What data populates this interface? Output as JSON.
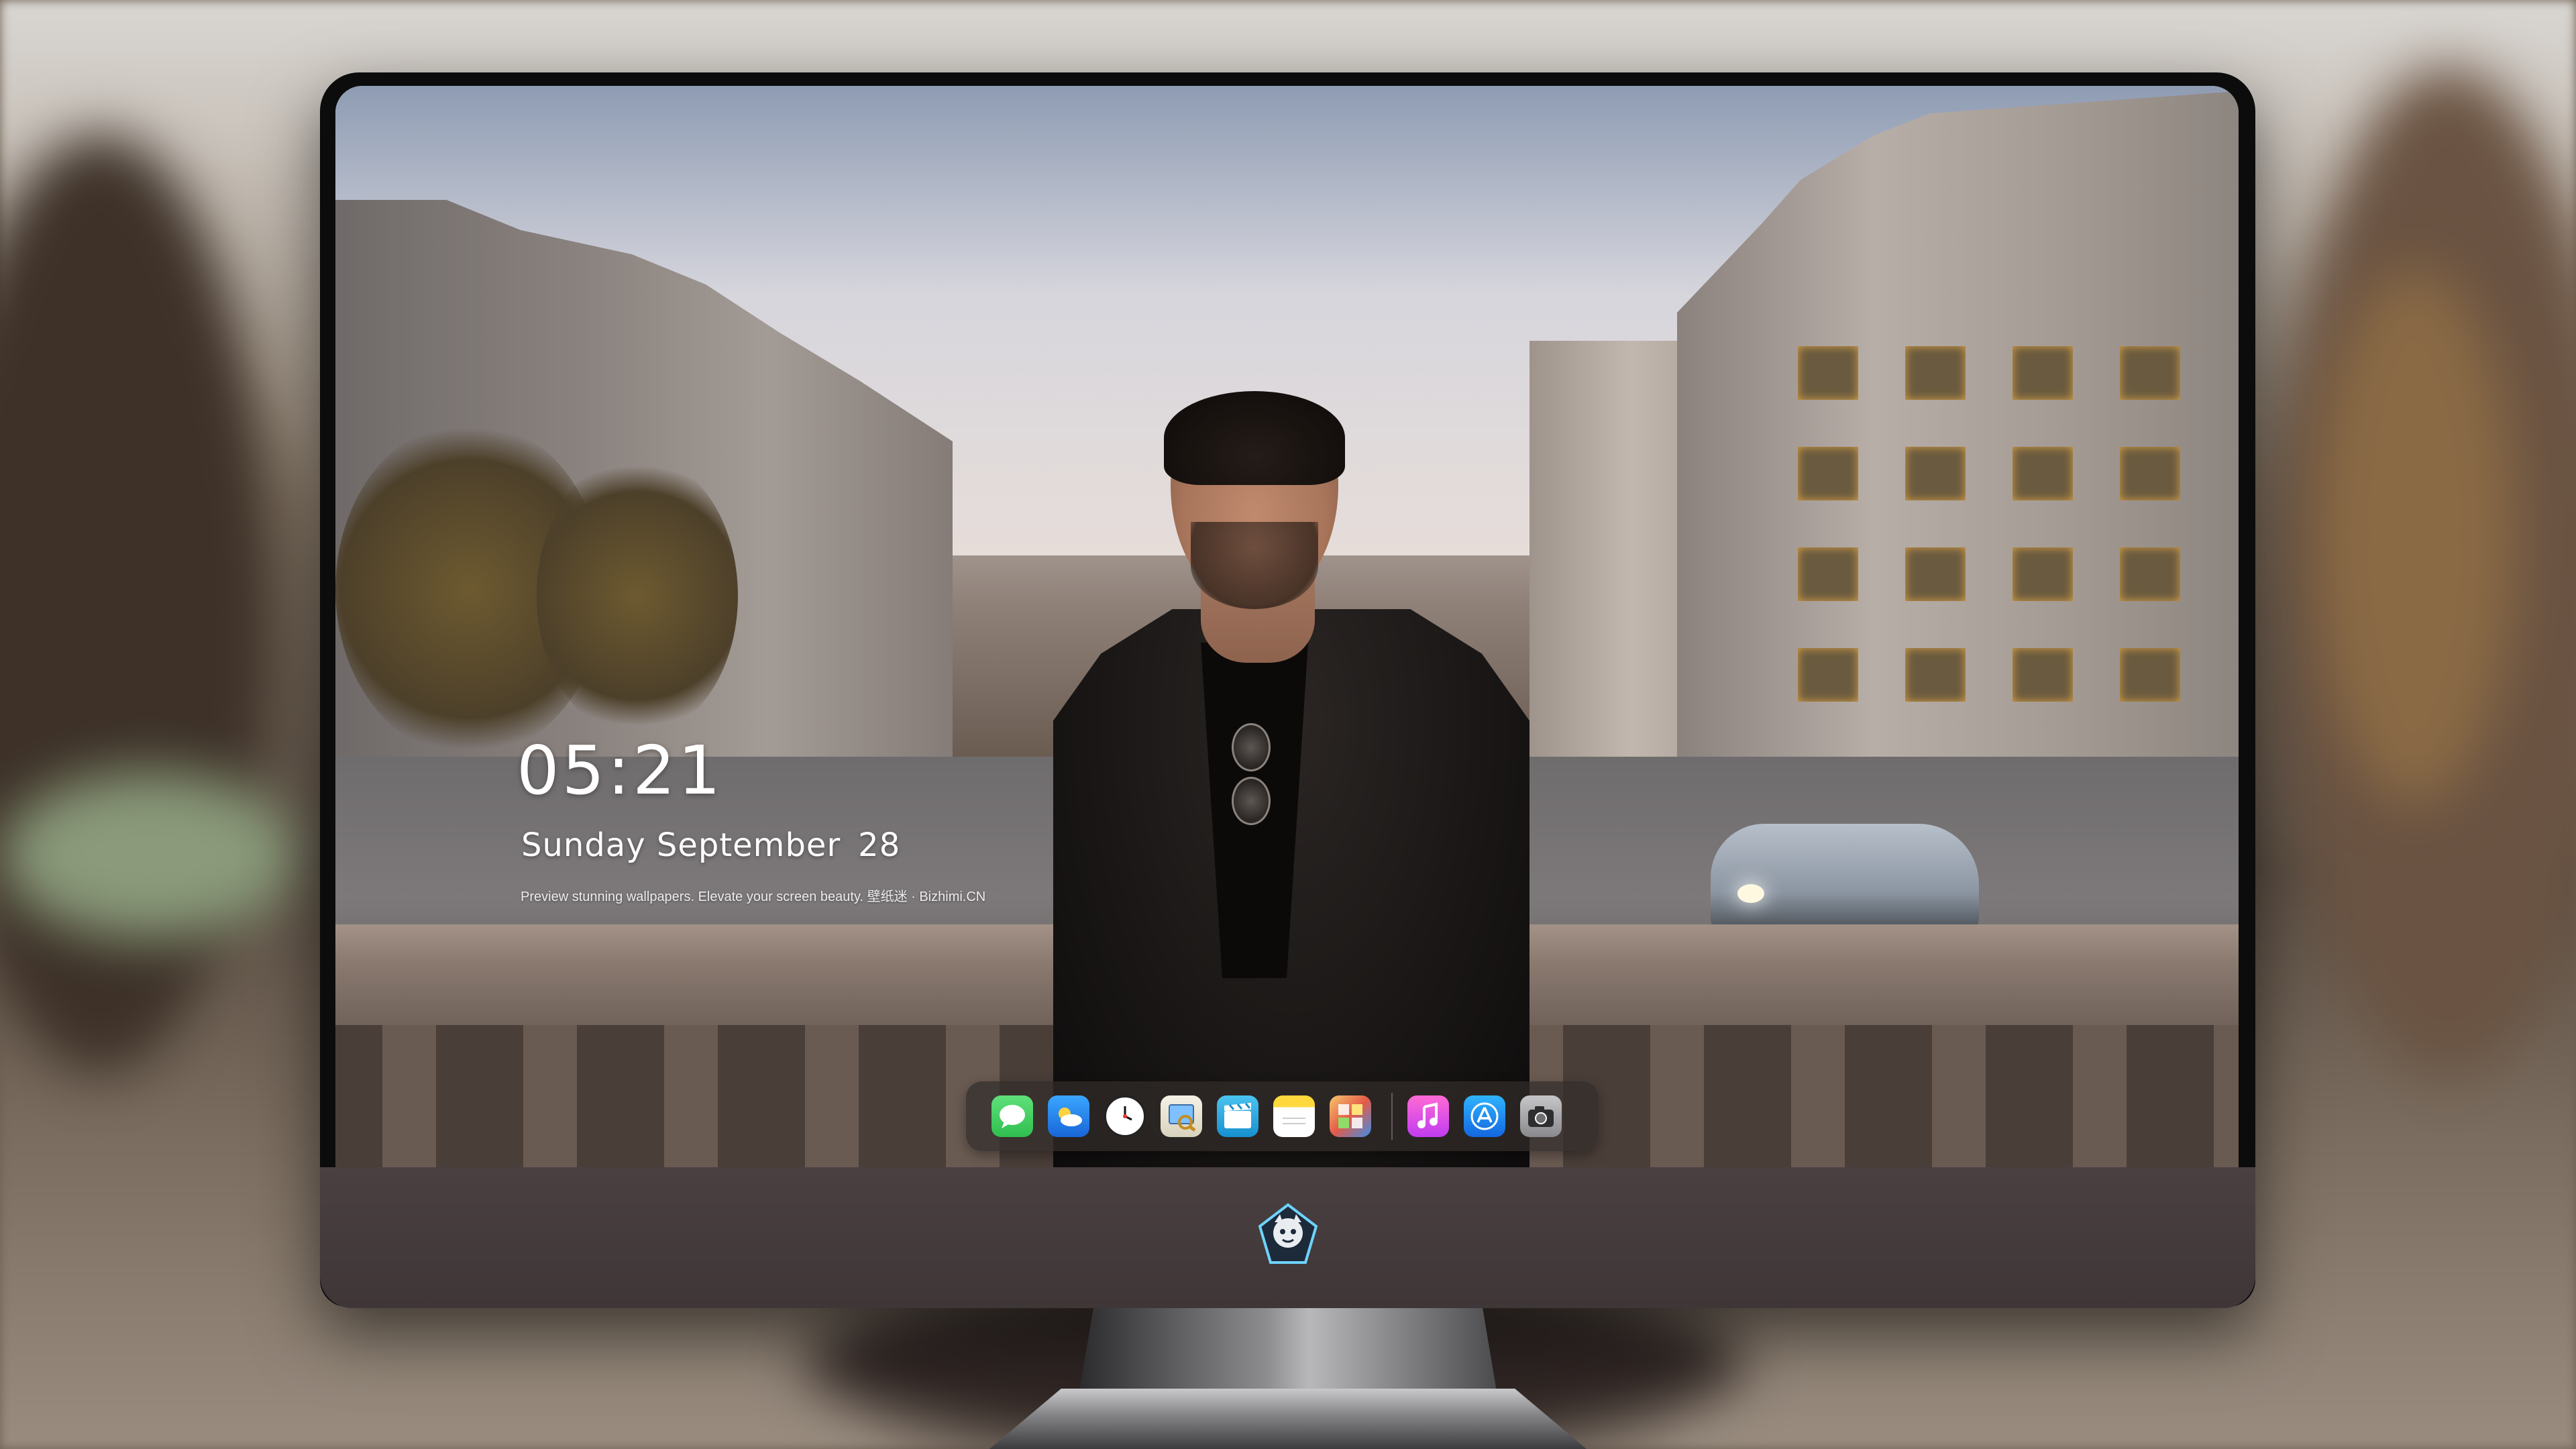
{
  "lockscreen": {
    "time": "05:21",
    "weekday_month": "Sunday September",
    "day": "28",
    "tagline": "Preview stunning wallpapers. Elevate your screen beauty. 壁纸迷 · Bizhimi.CN"
  },
  "dock": {
    "apps": [
      {
        "name": "Messages",
        "icon": "messages-icon",
        "color": "#34c759"
      },
      {
        "name": "Weather",
        "icon": "weather-icon",
        "color": "#1e90ff"
      },
      {
        "name": "Clock",
        "icon": "clock-icon",
        "color": "#ffffff"
      },
      {
        "name": "Preview",
        "icon": "preview-icon",
        "color": "#f2c84b"
      },
      {
        "name": "Clips",
        "icon": "clips-icon",
        "color": "#3bb3e8"
      },
      {
        "name": "Notes",
        "icon": "notes-icon",
        "color": "#ffd83d"
      },
      {
        "name": "Photo Booth",
        "icon": "photo-booth-icon",
        "color": "#e94b3c"
      },
      {
        "name": "iTunes",
        "icon": "music-icon",
        "color": "#e040c8"
      },
      {
        "name": "App Store",
        "icon": "app-store-icon",
        "color": "#1c8cf2"
      },
      {
        "name": "Camera",
        "icon": "camera-icon",
        "color": "#8e8e93"
      }
    ]
  },
  "monitor": {
    "chin_logo": "mascot-logo"
  },
  "colors": {
    "chin": "#433a3c",
    "bezel": "#0c0c0c",
    "dock_bg": "rgba(50,44,42,0.72)"
  }
}
